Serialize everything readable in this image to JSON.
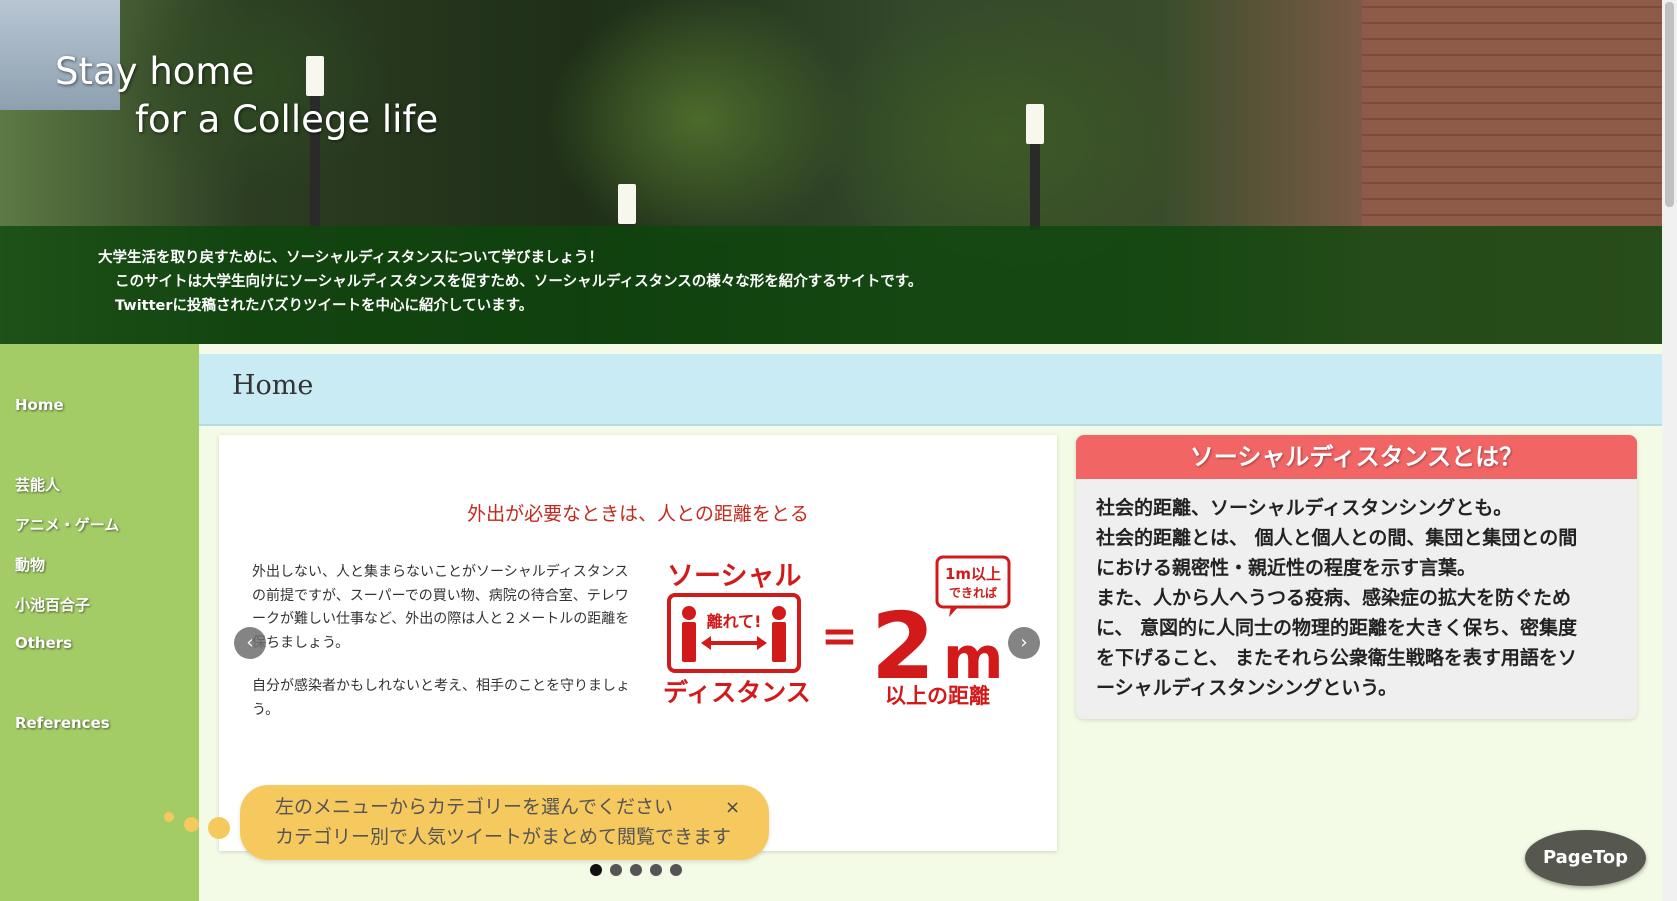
{
  "hero": {
    "title_line1": "Stay home",
    "title_line2": "for a College life",
    "band_line1": "大学生活を取り戻すために、ソーシャルディスタンスについて学びましょう！",
    "band_line2": "このサイトは大学生向けにソーシャルディスタンスを促すため、ソーシャルディスタンスの様々な形を紹介するサイトです。",
    "band_line3": "Twitterに投稿されたバズりツイートを中心に紹介しています。"
  },
  "sidebar": {
    "items": [
      {
        "label": "Home"
      },
      {
        "label": "芸能人"
      },
      {
        "label": "アニメ・ゲーム"
      },
      {
        "label": "動物"
      },
      {
        "label": "小池百合子"
      },
      {
        "label": "Others"
      },
      {
        "label": "References"
      }
    ]
  },
  "page": {
    "title": "Home"
  },
  "slider": {
    "slide_title": "外出が必要なときは、人との距離をとる",
    "paragraph1": "外出しない、人と集まらないことがソーシャルディスタンスの前提ですが、スーパーでの買い物、病院の待合室、テレワークが難しい仕事など、外出の際は人と２メートルの距離を保ちましょう。",
    "paragraph2": "自分が感染者かもしれないと考え、相手のことを守りましょう。",
    "graphic": {
      "top_text": "ソーシャル",
      "mid_text": "離れて!",
      "bottom_text": "ディスタンス",
      "equals": "=",
      "big_number": "2",
      "big_unit": "m",
      "callout_line1": "1m以上",
      "callout_line2": "できれば",
      "caption": "以上の距離"
    },
    "prev_icon": "‹",
    "next_icon": "›",
    "slide_count": 5,
    "active_index": 0
  },
  "info": {
    "heading": "ソーシャルディスタンスとは？",
    "lines": [
      "社会的距離、ソーシャルディスタンシングとも。",
      "社会的距離とは、 個人と個人との間、集団と集団との間",
      "における親密性・親近性の程度を示す言葉。",
      "また、人から人へうつる疫病、感染症の拡大を防ぐため",
      "に、 意図的に人同士の物理的距離を大きく保ち、密集度",
      "を下げること、 またそれら公衆衛生戦略を表す用語をソ",
      "ーシャルディスタンシングという。"
    ]
  },
  "toast": {
    "line1": "左のメニューからカテゴリーを選んでください",
    "line2": "カテゴリー別で人気ツイートがまとめて閲覧できます",
    "close": "×"
  },
  "pagetop": {
    "label": "PageTop"
  },
  "colors": {
    "sidebar": "#a3cc66",
    "header": "#c9ecf4",
    "accent_red": "#f26565",
    "toast": "#f6c95f"
  }
}
